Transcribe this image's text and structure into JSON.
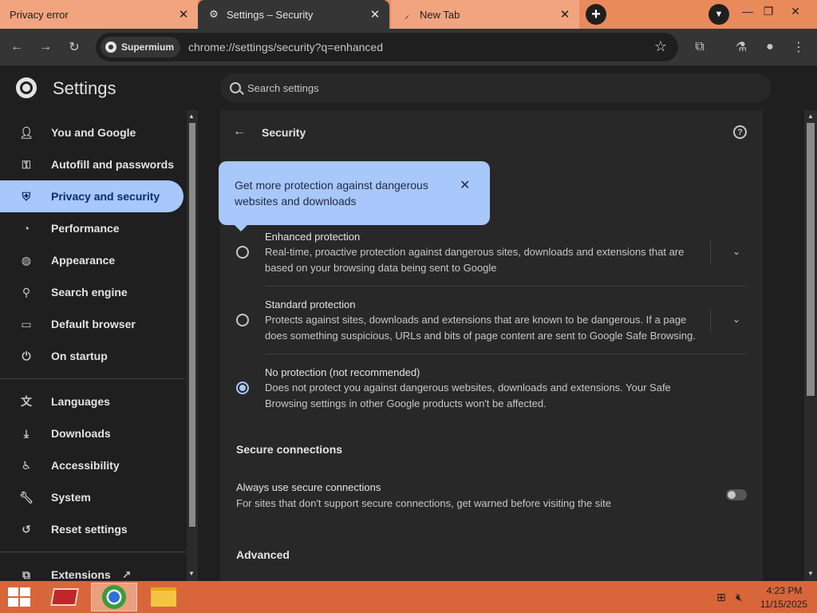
{
  "tabs": [
    {
      "title": "Privacy error",
      "close": "✕"
    },
    {
      "title": "Settings – Security",
      "close": "✕"
    },
    {
      "title": "New Tab",
      "close": "✕"
    }
  ],
  "toolbar": {
    "chip_label": "Supermium",
    "url": "chrome://settings/security?q=enhanced"
  },
  "header": {
    "title": "Settings",
    "search_placeholder": "Search settings"
  },
  "sidebar": {
    "items": [
      {
        "label": "You and Google",
        "icon": "person-icon"
      },
      {
        "label": "Autofill and passwords",
        "icon": "key-icon"
      },
      {
        "label": "Privacy and security",
        "icon": "shield-icon"
      },
      {
        "label": "Performance",
        "icon": "speedometer-icon"
      },
      {
        "label": "Appearance",
        "icon": "palette-icon"
      },
      {
        "label": "Search engine",
        "icon": "search-icon"
      },
      {
        "label": "Default browser",
        "icon": "browser-icon"
      },
      {
        "label": "On startup",
        "icon": "power-icon"
      },
      {
        "label": "Languages",
        "icon": "translate-icon"
      },
      {
        "label": "Downloads",
        "icon": "download-icon"
      },
      {
        "label": "Accessibility",
        "icon": "accessibility-icon"
      },
      {
        "label": "System",
        "icon": "wrench-icon"
      },
      {
        "label": "Reset settings",
        "icon": "reset-icon"
      },
      {
        "label": "Extensions",
        "icon": "puzzle-icon"
      }
    ],
    "active": "Privacy and security"
  },
  "main": {
    "page_title": "Security",
    "callout": {
      "text": "Get more protection against dangerous websites and downloads",
      "close": "✕"
    },
    "options": [
      {
        "title": "Enhanced protection",
        "description": "Real-time, proactive protection against dangerous sites, downloads and extensions that are based on your browsing data being sent to Google",
        "selected": false
      },
      {
        "title": "Standard protection",
        "description": "Protects against sites, downloads and extensions that are known to be dangerous. If a page does something suspicious, URLs and bits of page content are sent to Google Safe Browsing.",
        "selected": false
      },
      {
        "title": "No protection (not recommended)",
        "description": "Does not protect you against dangerous websites, downloads and extensions. Your Safe Browsing settings in other Google products won't be affected.",
        "selected": true
      }
    ],
    "secure_connections": {
      "section_title": "Secure connections",
      "row_title": "Always use secure connections",
      "row_desc": "For sites that don't support secure connections, get warned before visiting the site",
      "toggle_on": false
    },
    "advanced_title": "Advanced"
  },
  "taskbar": {
    "time": "4:23 PM",
    "date": "11/15/2025"
  },
  "colors": {
    "accent": "#a8c7fa",
    "tabstrip": "#e98a5b",
    "taskbar": "#d8663a"
  }
}
